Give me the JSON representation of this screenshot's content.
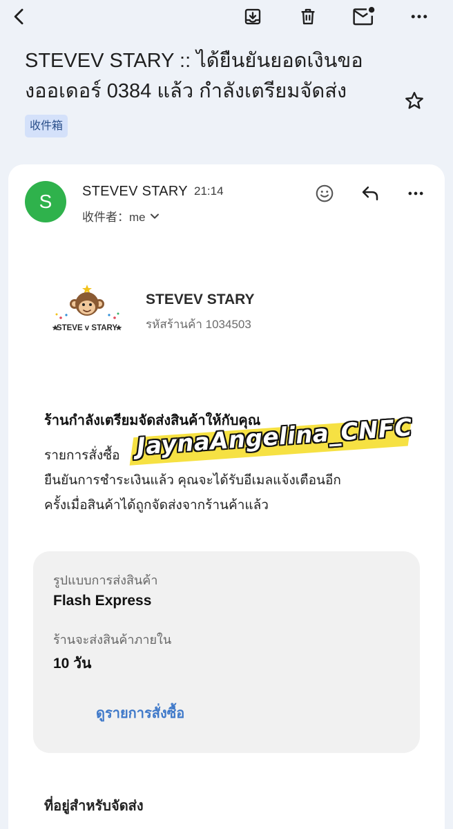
{
  "toolbar": {
    "back_icon": "arrow-back-icon",
    "archive_icon": "archive-icon",
    "delete_icon": "trash-icon",
    "unread_icon": "mail-unread-icon",
    "more_icon": "more-vert-icon"
  },
  "email": {
    "subject_line1": "STEVEV STARY :: ได้ยืนยันยอดเงินขอ",
    "subject_line2": "งออเดอร์ 0384 แล้ว กำลังเตรียมจัดส่ง",
    "label": "收件箱",
    "star_icon": "star-outline-icon"
  },
  "sender": {
    "avatar_letter": "S",
    "avatar_color": "#2fb24c",
    "name": "STEVEV STARY",
    "time": "21:14",
    "recipient": "收件者：me",
    "react_icon": "emoji-icon",
    "reply_icon": "reply-icon",
    "more_icon": "more-vert-icon"
  },
  "store": {
    "logo_text": "STEVE v STARY",
    "name": "STEVEV STARY",
    "code": "รหัสร้านค้า 1034503"
  },
  "message": {
    "headline": "ร้านกำลังเตรียมจัดส่งสินค้าให้กับคุณ",
    "line1": "รายการสั่งซื้อ",
    "line2": "ยืนยันการชำระเงินแล้ว คุณจะได้รับอีเมลแจ้งเตือนอีก",
    "line3": "ครั้งเมื่อสินค้าได้ถูกจัดส่งจากร้านค้าแล้ว"
  },
  "watermark": {
    "text": "JaynaAngelina_CNFC",
    "highlight_color": "#f6df39"
  },
  "shipping": {
    "method_label": "รูปแบบการส่งสินค้า",
    "method_value": "Flash Express",
    "eta_label": "ร้านจะส่งสินค้าภายใน",
    "eta_value": "10 วัน",
    "view_order_link": "ดูรายการสั่งซื้อ"
  },
  "address": {
    "title": "ที่อยู่สำหรับจัดส่ง"
  },
  "colors": {
    "background": "#eef2f8",
    "label_chip": "#d4e1fa",
    "link": "#3f79c9"
  }
}
